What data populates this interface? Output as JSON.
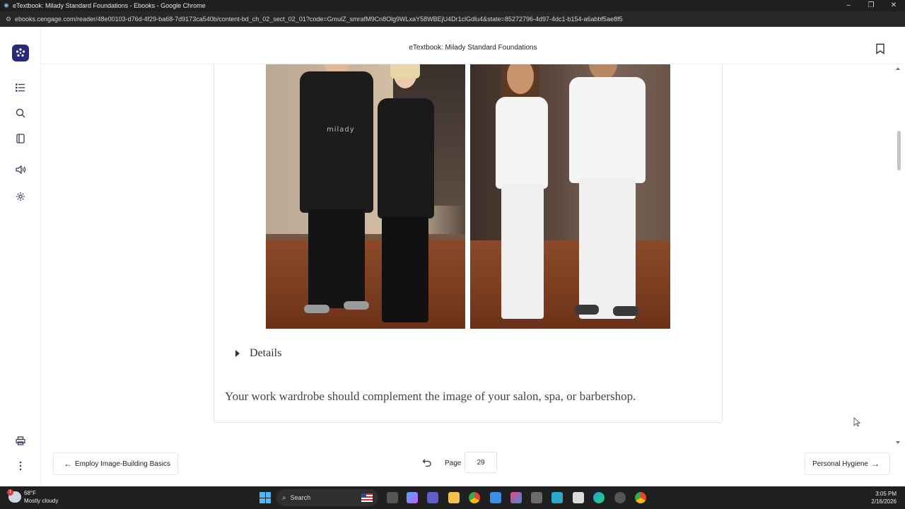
{
  "browser": {
    "tab_title": "eTextbook: Milady Standard Foundations - Ebooks - Google Chrome",
    "url": "ebooks.cengage.com/reader/48e00103-d76d-4f29-ba68-7d9173ca540b/content-bd_ch_02_sect_02_01?code=GmulZ_smrafM9Cn8Olg9WLxaY58WBEjU4Dr1clGdlu4&state=85272796-4d97-4dc1-b154-a6abbf5ae8f5",
    "controls": {
      "minimize": "–",
      "restore": "❐",
      "close": "✕"
    }
  },
  "header": {
    "title": "eTextbook: Milady Standard Foundations"
  },
  "sidebar": {
    "items": [
      {
        "name": "table-of-contents",
        "icon": "list-icon"
      },
      {
        "name": "search",
        "icon": "search-icon"
      },
      {
        "name": "notebook",
        "icon": "notebook-icon"
      },
      {
        "name": "read-aloud",
        "icon": "speaker-icon"
      },
      {
        "name": "settings",
        "icon": "gear-icon"
      }
    ],
    "bottom": [
      {
        "name": "print",
        "icon": "print-icon"
      },
      {
        "name": "more",
        "icon": "more-vertical-icon"
      }
    ]
  },
  "content": {
    "photo_left_apron_text": "milady",
    "details_label": "Details",
    "caption": "Your work wardrobe should complement the image of your salon, spa, or barbershop."
  },
  "footer": {
    "prev_label": "Employ Image-Building Basics",
    "next_label": "Personal Hygiene",
    "page_label": "Page",
    "page_value": "29"
  },
  "taskbar": {
    "weather_temp": "68°F",
    "weather_desc": "Mostly cloudy",
    "weather_badge": "1",
    "search_placeholder": "Search",
    "time": "3:05 PM",
    "date": "2/16/2026"
  },
  "colors": {
    "brand": "#2a2a7a",
    "titlebar": "#1f1f1f",
    "taskbar": "#202020"
  }
}
